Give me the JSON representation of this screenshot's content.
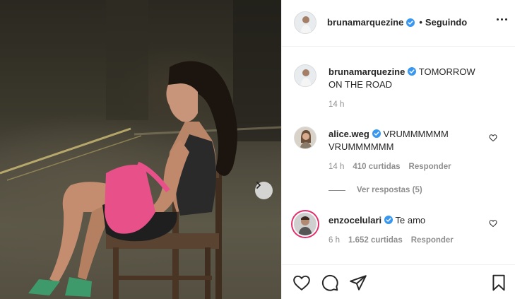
{
  "post": {
    "username": "brunamarquezine",
    "follow_status": "Seguindo",
    "verified_icon": "verified-badge-icon",
    "caption": "TOMORROW ON THE ROAD",
    "caption_time": "14 h"
  },
  "comments": [
    {
      "username": "alice.weg",
      "text": "VRUMMMMMM VRUMMMMMM",
      "time": "14 h",
      "likes": "410 curtidas",
      "reply_label": "Responder",
      "view_replies": "Ver respostas (5)"
    },
    {
      "username": "enzocelulari",
      "text": "Te amo",
      "time": "6 h",
      "likes": "1.652 curtidas",
      "reply_label": "Responder"
    }
  ],
  "icons": {
    "like": "heart-icon",
    "comment": "comment-icon",
    "share": "share-icon",
    "save": "bookmark-icon",
    "next": "chevron-right-icon",
    "more": "more-options-icon"
  },
  "colors": {
    "verified": "#3897f0",
    "text": "#262626",
    "muted": "#8e8e8e",
    "border": "#efefef",
    "bag": "#e8508a"
  }
}
